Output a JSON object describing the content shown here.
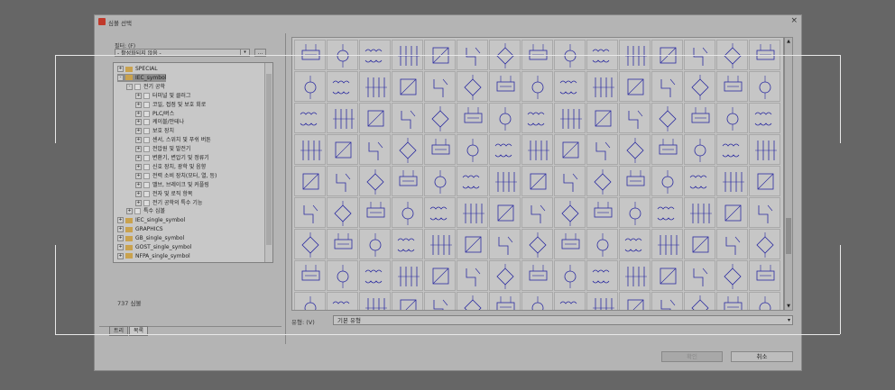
{
  "window": {
    "title": "심볼 선택",
    "close_glyph": "×"
  },
  "filter": {
    "label": "필터: (F)",
    "value": "- 활성화되지 않음 -",
    "more_button": "..."
  },
  "tree": {
    "items": [
      {
        "label": "SPECIAL",
        "icon": "folder-icon",
        "expander": "+"
      },
      {
        "label": "IEC_symbol",
        "icon": "folder-icon",
        "expander": "-",
        "selected": true
      },
      {
        "label": "전기 공학",
        "icon": "doc-icon",
        "expander": "-"
      },
      {
        "label": "터미널 및 클러그",
        "icon": "doc-icon",
        "expander": "+"
      },
      {
        "label": "코일, 접점 및 보호 회로",
        "icon": "doc-icon",
        "expander": "+"
      },
      {
        "label": "PLC/버스",
        "icon": "doc-icon",
        "expander": "+"
      },
      {
        "label": "케이블/안테나",
        "icon": "doc-icon",
        "expander": "+"
      },
      {
        "label": "보호 장치",
        "icon": "doc-icon",
        "expander": "+"
      },
      {
        "label": "센서, 스위치 및 푸쉬 버튼",
        "icon": "doc-icon",
        "expander": "+"
      },
      {
        "label": "전압원 및 발전기",
        "icon": "doc-icon",
        "expander": "+"
      },
      {
        "label": "변환기, 변압기 및 정류기",
        "icon": "doc-icon",
        "expander": "+"
      },
      {
        "label": "신호 장치, 광학 및 음향",
        "icon": "doc-icon",
        "expander": "+"
      },
      {
        "label": "전력 소비 장치(모터, 열, 등)",
        "icon": "doc-icon",
        "expander": "+"
      },
      {
        "label": "밸브, 브레이크 및 커플링",
        "icon": "doc-icon",
        "expander": "+"
      },
      {
        "label": "전자 및 로직 항목",
        "icon": "doc-icon",
        "expander": "+"
      },
      {
        "label": "전기 공학의 특수 기능",
        "icon": "doc-icon",
        "expander": "+"
      },
      {
        "label": "특수 심볼",
        "icon": "doc-icon",
        "expander": "+"
      },
      {
        "label": "IEC_single_symbol",
        "icon": "folder-icon",
        "expander": "+"
      },
      {
        "label": "GRAPHICS",
        "icon": "folder-icon",
        "expander": "+"
      },
      {
        "label": "GB_single_symbol",
        "icon": "folder-icon",
        "expander": "+"
      },
      {
        "label": "GOST_single_symbol",
        "icon": "folder-icon",
        "expander": "+"
      },
      {
        "label": "NFPA_single_symbol",
        "icon": "folder-icon",
        "expander": "+"
      }
    ]
  },
  "symbol_count": "737 심볼",
  "tabs": [
    {
      "label": "트리"
    },
    {
      "label": "목록",
      "active": true
    }
  ],
  "type": {
    "label": "유형: (V)",
    "value": "기본 유형"
  },
  "buttons": {
    "ok": "확인",
    "cancel": "취소"
  },
  "colors": {
    "symbol_stroke": "#2a2aa0",
    "overlay": "#666666"
  }
}
